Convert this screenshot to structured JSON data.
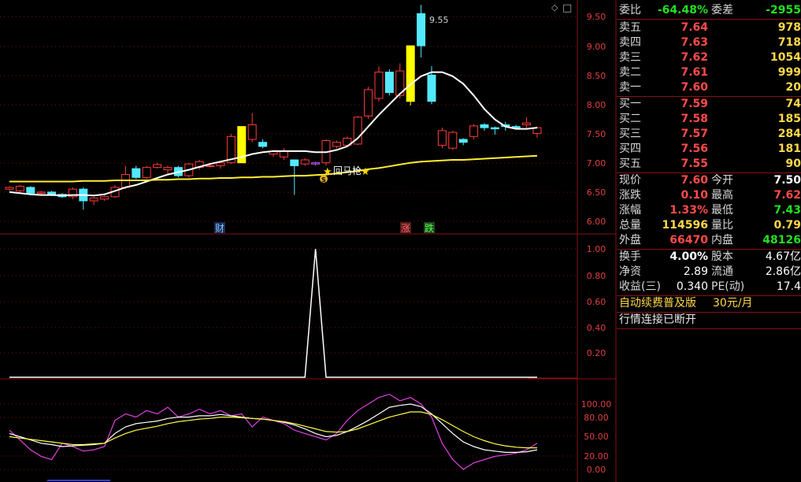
{
  "axis": {
    "main": [
      "9.50",
      "9.00",
      "8.50",
      "8.00",
      "7.50",
      "7.00",
      "6.50",
      "6.00"
    ],
    "mid": [
      "1.00",
      "0.80",
      "0.60",
      "0.40",
      "0.20"
    ],
    "low": [
      "100.00",
      "80.00",
      "50.00",
      "20.00",
      "0.00"
    ]
  },
  "annotations": {
    "high_price": "9.55",
    "signal_text": "回马枪",
    "star": "★",
    "s_badge": "S",
    "marker_cai": "财",
    "marker_zhang": "涨",
    "marker_die": "跌"
  },
  "icons": {
    "diamond": "◇",
    "window": "□"
  },
  "quote": {
    "wei_bi_label": "委比",
    "wei_bi": "-64.48%",
    "wei_cha_label": "委差",
    "wei_cha": "-2955",
    "sells": [
      {
        "label": "卖五",
        "price": "7.64",
        "vol": "978"
      },
      {
        "label": "卖四",
        "price": "7.63",
        "vol": "718"
      },
      {
        "label": "卖三",
        "price": "7.62",
        "vol": "1054"
      },
      {
        "label": "卖二",
        "price": "7.61",
        "vol": "999"
      },
      {
        "label": "卖一",
        "price": "7.60",
        "vol": "20"
      }
    ],
    "buys": [
      {
        "label": "买一",
        "price": "7.59",
        "vol": "74"
      },
      {
        "label": "买二",
        "price": "7.58",
        "vol": "185"
      },
      {
        "label": "买三",
        "price": "7.57",
        "vol": "284"
      },
      {
        "label": "买四",
        "price": "7.56",
        "vol": "181"
      },
      {
        "label": "买五",
        "price": "7.55",
        "vol": "90"
      }
    ],
    "stats": [
      {
        "l1": "现价",
        "v1": "7.60",
        "l2": "今开",
        "v2": "7.50"
      },
      {
        "l1": "涨跌",
        "v1": "0.10",
        "l2": "最高",
        "v2": "7.62"
      },
      {
        "l1": "涨幅",
        "v1": "1.33%",
        "l2": "最低",
        "v2": "7.43"
      },
      {
        "l1": "总量",
        "v1": "114596",
        "l2": "量比",
        "v2": "0.79"
      },
      {
        "l1": "外盘",
        "v1": "66470",
        "l2": "内盘",
        "v2": "48126"
      }
    ],
    "fin": [
      {
        "l1": "换手",
        "v1": "4.00%",
        "l2": "股本",
        "v2": "4.67亿"
      },
      {
        "l1": "净资",
        "v1": "2.89",
        "l2": "流通",
        "v2": "2.86亿"
      },
      {
        "l1": "收益(三)",
        "v1": "0.340",
        "l2": "PE(动)",
        "v2": "17.4"
      }
    ],
    "promo": "自动续费普及版",
    "promo_price": "30元/月",
    "status": "行情连接已断开"
  },
  "chart_data": [
    {
      "type": "candlestick",
      "ylim": [
        5.85,
        9.68
      ],
      "last_high_label": "9.55",
      "candles": [
        [
          6.55,
          6.58,
          6.6,
          6.52
        ],
        [
          6.52,
          6.6,
          6.62,
          6.5
        ],
        [
          6.58,
          6.48,
          6.6,
          6.45
        ],
        [
          6.48,
          6.5,
          6.52,
          6.44
        ],
        [
          6.5,
          6.46,
          6.52,
          6.43
        ],
        [
          6.46,
          6.42,
          6.48,
          6.4
        ],
        [
          6.42,
          6.55,
          6.58,
          6.38
        ],
        [
          6.55,
          6.35,
          6.58,
          6.2
        ],
        [
          6.35,
          6.4,
          6.42,
          6.28
        ],
        [
          6.38,
          6.42,
          6.44,
          6.35
        ],
        [
          6.42,
          6.58,
          6.62,
          6.4
        ],
        [
          6.58,
          6.8,
          6.95,
          6.55
        ],
        [
          6.9,
          6.75,
          6.95,
          6.72
        ],
        [
          6.75,
          6.92,
          6.95,
          6.72
        ],
        [
          6.92,
          6.97,
          7.0,
          6.9
        ],
        [
          6.88,
          6.92,
          6.95,
          6.8
        ],
        [
          6.92,
          6.78,
          6.95,
          6.75
        ],
        [
          6.78,
          6.98,
          7.0,
          6.75
        ],
        [
          6.92,
          7.02,
          7.05,
          6.88
        ],
        [
          6.95,
          6.95,
          7.0,
          6.92
        ],
        [
          6.95,
          7.0,
          7.02,
          6.9
        ],
        [
          7.0,
          7.45,
          7.5,
          6.98
        ],
        [
          7.0,
          7.62,
          7.62,
          7.0
        ],
        [
          7.4,
          7.65,
          7.85,
          7.35
        ],
        [
          7.35,
          7.28,
          7.4,
          7.25
        ],
        [
          7.15,
          7.2,
          7.22,
          7.1
        ],
        [
          7.1,
          7.2,
          7.25,
          7.05
        ],
        [
          7.05,
          6.95,
          7.05,
          6.45
        ],
        [
          6.98,
          7.05,
          7.08,
          6.95
        ],
        [
          6.98,
          7.0,
          7.02,
          6.95
        ],
        [
          7.0,
          7.38,
          7.4,
          6.95
        ],
        [
          7.28,
          7.35,
          7.38,
          7.25
        ],
        [
          7.3,
          7.42,
          7.45,
          7.28
        ],
        [
          7.32,
          7.78,
          7.8,
          7.3
        ],
        [
          7.8,
          8.25,
          8.3,
          7.75
        ],
        [
          8.1,
          8.55,
          8.65,
          8.05
        ],
        [
          8.55,
          8.2,
          8.6,
          8.15
        ],
        [
          8.15,
          8.57,
          8.7,
          8.1
        ],
        [
          8.05,
          9.0,
          9.0,
          7.98
        ],
        [
          9.55,
          9.0,
          9.7,
          8.8
        ],
        [
          8.5,
          8.05,
          8.65,
          8.0
        ],
        [
          7.3,
          7.55,
          7.6,
          7.25
        ],
        [
          7.25,
          7.52,
          7.55,
          7.22
        ],
        [
          7.4,
          7.35,
          7.42,
          7.3
        ],
        [
          7.45,
          7.63,
          7.66,
          7.4
        ],
        [
          7.65,
          7.6,
          7.68,
          7.55
        ],
        [
          7.6,
          7.58,
          7.62,
          7.48
        ],
        [
          7.65,
          7.62,
          7.7,
          7.55
        ],
        [
          7.62,
          7.6,
          7.65,
          7.58
        ],
        [
          7.65,
          7.68,
          7.78,
          7.6
        ],
        [
          7.5,
          7.6,
          7.62,
          7.43
        ]
      ],
      "ma_short": [
        6.5,
        6.48,
        6.46,
        6.45,
        6.45,
        6.44,
        6.45,
        6.45,
        6.44,
        6.46,
        6.52,
        6.58,
        6.62,
        6.68,
        6.74,
        6.8,
        6.84,
        6.88,
        6.93,
        6.98,
        7.02,
        7.06,
        7.1,
        7.15,
        7.18,
        7.2,
        7.2,
        7.2,
        7.2,
        7.18,
        7.18,
        7.22,
        7.28,
        7.42,
        7.62,
        7.82,
        8.0,
        8.18,
        8.34,
        8.48,
        8.55,
        8.55,
        8.48,
        8.35,
        8.15,
        7.92,
        7.74,
        7.62,
        7.58,
        7.58,
        7.6
      ],
      "ma_long": [
        6.68,
        6.68,
        6.68,
        6.68,
        6.68,
        6.68,
        6.68,
        6.69,
        6.69,
        6.69,
        6.7,
        6.7,
        6.7,
        6.7,
        6.71,
        6.71,
        6.72,
        6.72,
        6.73,
        6.73,
        6.74,
        6.74,
        6.75,
        6.75,
        6.76,
        6.76,
        6.77,
        6.78,
        6.78,
        6.79,
        6.8,
        6.82,
        6.84,
        6.86,
        6.89,
        6.91,
        6.94,
        6.97,
        7.0,
        7.02,
        7.03,
        7.04,
        7.05,
        7.05,
        7.06,
        7.07,
        7.08,
        7.09,
        7.1,
        7.11,
        7.12
      ]
    },
    {
      "type": "line",
      "ylim": [
        0,
        1.05
      ],
      "values": [
        0,
        0,
        0,
        0,
        0,
        0,
        0,
        0,
        0,
        0,
        0,
        0,
        0,
        0,
        0,
        0,
        0,
        0,
        0,
        0,
        0,
        0,
        0,
        0,
        0,
        0,
        0,
        0,
        0,
        1,
        0,
        0,
        0,
        0,
        0,
        0,
        0,
        0,
        0,
        0,
        0,
        0,
        0,
        0,
        0,
        0,
        0,
        0,
        0,
        0,
        0
      ],
      "signal_index": 29
    },
    {
      "type": "line",
      "ylim": [
        0,
        115
      ],
      "series": [
        {
          "values": [
            60,
            45,
            30,
            20,
            15,
            40,
            35,
            28,
            30,
            35,
            75,
            85,
            80,
            90,
            85,
            95,
            80,
            85,
            92,
            85,
            90,
            82,
            85,
            65,
            80,
            75,
            70,
            60,
            55,
            50,
            45,
            55,
            75,
            90,
            100,
            110,
            115,
            105,
            110,
            100,
            80,
            40,
            15,
            0,
            10,
            15,
            20,
            22,
            25,
            30,
            40
          ]
        },
        {
          "values": [
            55,
            50,
            45,
            40,
            38,
            35,
            36,
            37,
            38,
            40,
            55,
            65,
            70,
            72,
            74,
            78,
            80,
            80,
            82,
            82,
            84,
            82,
            80,
            78,
            77,
            75,
            72,
            68,
            62,
            55,
            50,
            52,
            58,
            66,
            75,
            85,
            95,
            98,
            100,
            96,
            85,
            70,
            55,
            42,
            35,
            30,
            28,
            26,
            26,
            27,
            30
          ]
        },
        {
          "values": [
            50,
            48,
            46,
            44,
            42,
            40,
            38,
            38,
            39,
            40,
            48,
            55,
            60,
            63,
            66,
            70,
            73,
            75,
            77,
            78,
            80,
            80,
            79,
            78,
            77,
            75,
            73,
            70,
            66,
            62,
            58,
            57,
            58,
            62,
            68,
            74,
            80,
            84,
            88,
            88,
            84,
            76,
            67,
            58,
            50,
            44,
            39,
            36,
            34,
            33,
            33
          ]
        }
      ]
    }
  ]
}
